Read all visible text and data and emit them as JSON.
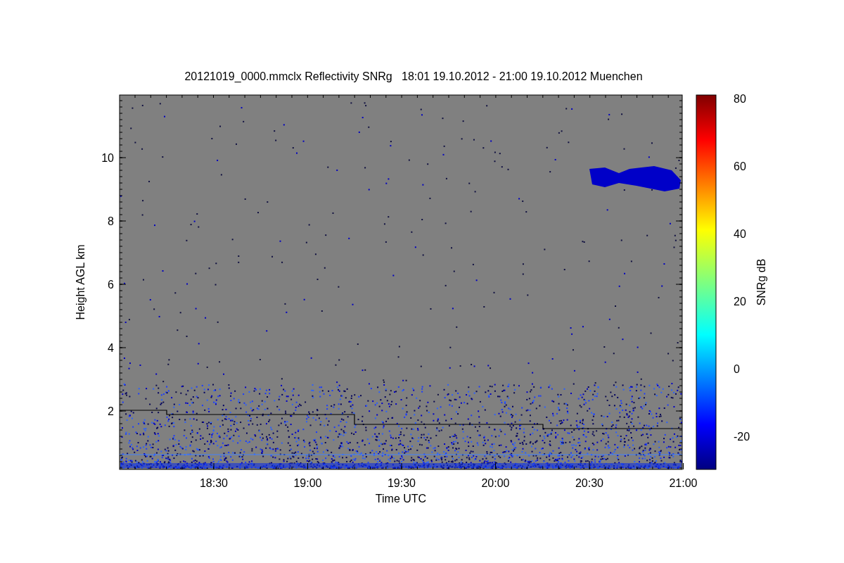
{
  "figure": {
    "title": "20121019_0000.mmclx Reflectivity SNRg   18:01 19.10.2012 - 21:00 19.10.2012 Muenchen",
    "y_axis": {
      "label": "Height AGL km",
      "ticks": [
        "10",
        "8",
        "6",
        "4",
        "2"
      ]
    },
    "x_axis": {
      "label": "Time UTC",
      "ticks": [
        "18:30",
        "19:00",
        "19:30",
        "20:00",
        "20:30",
        "21:00"
      ]
    },
    "colorbar": {
      "label": "SNRg dB",
      "ticks": [
        "80",
        "60",
        "40",
        "20",
        "0",
        "-20"
      ]
    }
  }
}
